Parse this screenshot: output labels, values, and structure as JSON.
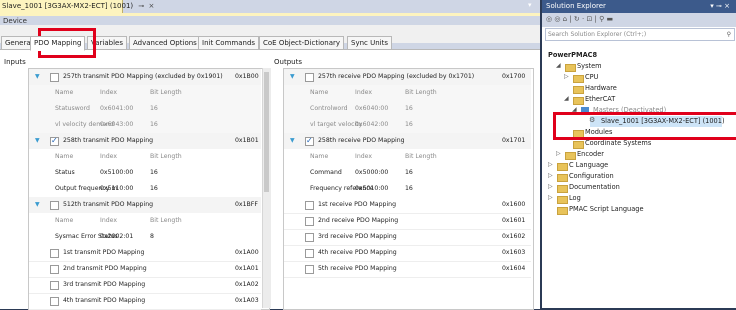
{
  "doc_tab": {
    "title": "Slave_1001 [3G3AX-MX2-ECT] (1001)",
    "pin": "⊸",
    "close": "×"
  },
  "device_label": "Device",
  "tabs": [
    "General",
    "PDO Mapping",
    "Variables",
    "Advanced Options",
    "Init Commands",
    "CoE Object-Dictionary",
    "Sync Units"
  ],
  "inputs": {
    "label": "Inputs",
    "col_headers": [
      "Name",
      "Index",
      "Bit Length"
    ],
    "groups": [
      {
        "title": "257th transmit PDO Mapping (excluded by 0x1901)",
        "index": "0x1B00",
        "checked": false,
        "expanded": true,
        "rows": [
          [
            "Statusword",
            "0x6041:00",
            "16"
          ],
          [
            "vl velocity demand",
            "0x6043:00",
            "16"
          ]
        ],
        "active": false
      },
      {
        "title": "258th transmit PDO Mapping",
        "index": "0x1B01",
        "checked": true,
        "expanded": true,
        "rows": [
          [
            "Status",
            "0x5100:00",
            "16"
          ],
          [
            "Output frequency m",
            "0x5110:00",
            "16"
          ]
        ],
        "active": true
      },
      {
        "title": "512th transmit PDO Mapping",
        "index": "0x1BFF",
        "checked": false,
        "expanded": true,
        "rows": [
          [
            "Sysmac Error Status",
            "0x2002:01",
            "8"
          ]
        ],
        "active": true
      }
    ],
    "items": [
      {
        "title": "1st transmit PDO Mapping",
        "index": "0x1A00"
      },
      {
        "title": "2nd transmit PDO Mapping",
        "index": "0x1A01"
      },
      {
        "title": "3rd transmit PDO Mapping",
        "index": "0x1A02"
      },
      {
        "title": "4th transmit PDO Mapping",
        "index": "0x1A03"
      }
    ]
  },
  "outputs": {
    "label": "Outputs",
    "col_headers": [
      "Name",
      "Index",
      "Bit Length"
    ],
    "groups": [
      {
        "title": "257th receive PDO Mapping (excluded by 0x1701)",
        "index": "0x1700",
        "checked": false,
        "expanded": true,
        "rows": [
          [
            "Controlword",
            "0x6040:00",
            "16"
          ],
          [
            "vl target velocity",
            "0x6042:00",
            "16"
          ]
        ],
        "active": false
      },
      {
        "title": "258th receive PDO Mapping",
        "index": "0x1701",
        "checked": true,
        "expanded": true,
        "rows": [
          [
            "Command",
            "0x5000:00",
            "16"
          ],
          [
            "Frequency reference",
            "0x5010:00",
            "16"
          ]
        ],
        "active": true
      }
    ],
    "items": [
      {
        "title": "1st receive PDO Mapping",
        "index": "0x1600"
      },
      {
        "title": "2nd receive PDO Mapping",
        "index": "0x1601"
      },
      {
        "title": "3rd receive PDO Mapping",
        "index": "0x1602"
      },
      {
        "title": "4th receive PDO Mapping",
        "index": "0x1603"
      },
      {
        "title": "5th receive PDO Mapping",
        "index": "0x1604"
      }
    ]
  },
  "solution_explorer": {
    "title": "Solution Explorer",
    "title_controls": "▾ ⊸ ×",
    "toolbar": "◎ ◎ ⌂ | ↻ · ⊡ | ⚲ ▬",
    "search_placeholder": "Search Solution Explorer (Ctrl+;)",
    "search_icon": "⚲",
    "tree": [
      {
        "label": "PowerPMAC8",
        "level": 0,
        "toggle": "",
        "icon": "none",
        "bold": true
      },
      {
        "label": "System",
        "level": 1,
        "toggle": "◢",
        "icon": "folder"
      },
      {
        "label": "CPU",
        "level": 2,
        "toggle": "▷",
        "icon": "folder"
      },
      {
        "label": "Hardware",
        "level": 2,
        "toggle": "",
        "icon": "folder"
      },
      {
        "label": "EtherCAT",
        "level": 2,
        "toggle": "◢",
        "icon": "folder"
      },
      {
        "label": "Masters (Deactivated)",
        "level": 3,
        "toggle": "◢",
        "icon": "blue"
      },
      {
        "label": "Slave_1001 [3G3AX-MX2-ECT] (1001)",
        "level": 4,
        "toggle": "",
        "icon": "gear",
        "selected": true
      },
      {
        "label": "Modules",
        "level": 2,
        "toggle": "",
        "icon": "folder"
      },
      {
        "label": "Coordinate Systems",
        "level": 2,
        "toggle": "",
        "icon": "folder"
      },
      {
        "label": "Encoder",
        "level": 1,
        "toggle": "▷",
        "icon": "folder"
      },
      {
        "label": "C Language",
        "level": 0,
        "toggle": "▷",
        "icon": "folder"
      },
      {
        "label": "Configuration",
        "level": 0,
        "toggle": "▷",
        "icon": "folder"
      },
      {
        "label": "Documentation",
        "level": 0,
        "toggle": "▷",
        "icon": "folder"
      },
      {
        "label": "Log",
        "level": 0,
        "toggle": "▷",
        "icon": "folder"
      },
      {
        "label": "PMAC Script Language",
        "level": 0,
        "toggle": "",
        "icon": "folder"
      }
    ]
  },
  "colors": {
    "highlight": "#e0001b",
    "accent": "#3c5a8b",
    "doc_tab": "#fdf4bf"
  }
}
